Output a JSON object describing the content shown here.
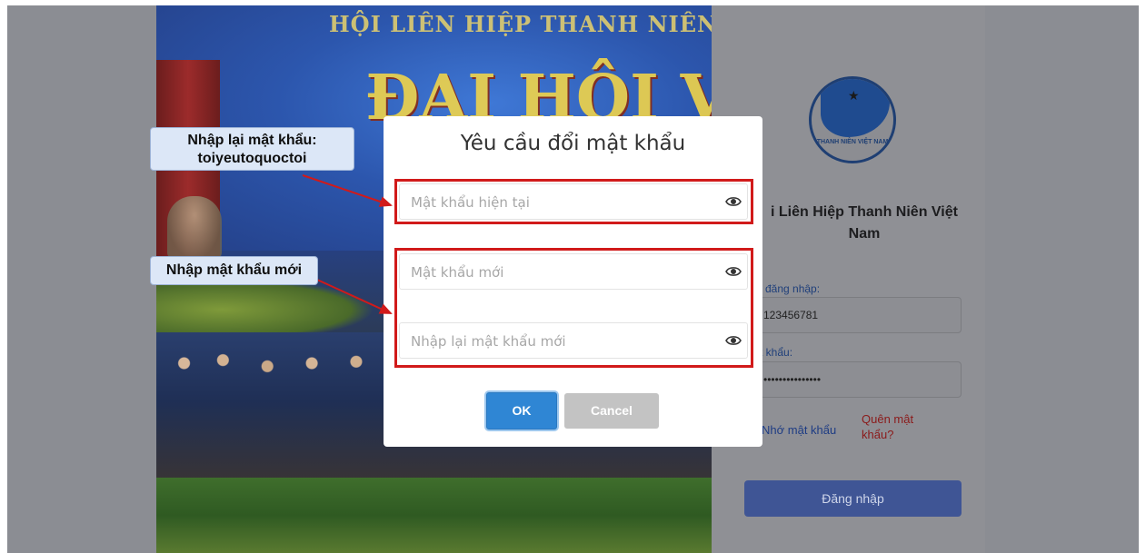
{
  "background_photo": {
    "banner_top": "HỘI LIÊN HIỆP THANH NIÊN VIỆT",
    "banner_big": "ĐẠI HỘI VIII"
  },
  "login_panel": {
    "logo_text": "THANH NIÊN VIỆT NAM",
    "org_name": "i Liên Hiệp Thanh Niên Việt Nam",
    "username_label": "đăng nhập:",
    "username_value": "123456781",
    "password_label": "t khẩu:",
    "password_value": "•••••••••••••••",
    "remember_label": "Nhớ mật khẩu",
    "forgot_label": "Quên mật khẩu?",
    "login_button": "Đăng nhập"
  },
  "modal": {
    "title": "Yêu cầu đổi mật khẩu",
    "current_password_placeholder": "Mật khẩu hiện tại",
    "new_password_placeholder": "Mật khẩu mới",
    "confirm_password_placeholder": "Nhập lại mật khẩu mới",
    "ok_button": "OK",
    "cancel_button": "Cancel"
  },
  "callouts": {
    "retype": "Nhập lại mật khẩu:\ntoiyeutoquoctoi",
    "new_password": "Nhập mật khẩu mới"
  },
  "colors": {
    "highlight": "#d11a1a",
    "ok_button": "#2f86d4",
    "cancel_button": "#c3c3c3",
    "callout_bg": "#dce7f7"
  },
  "icons": [
    "eye-icon",
    "star-icon"
  ]
}
